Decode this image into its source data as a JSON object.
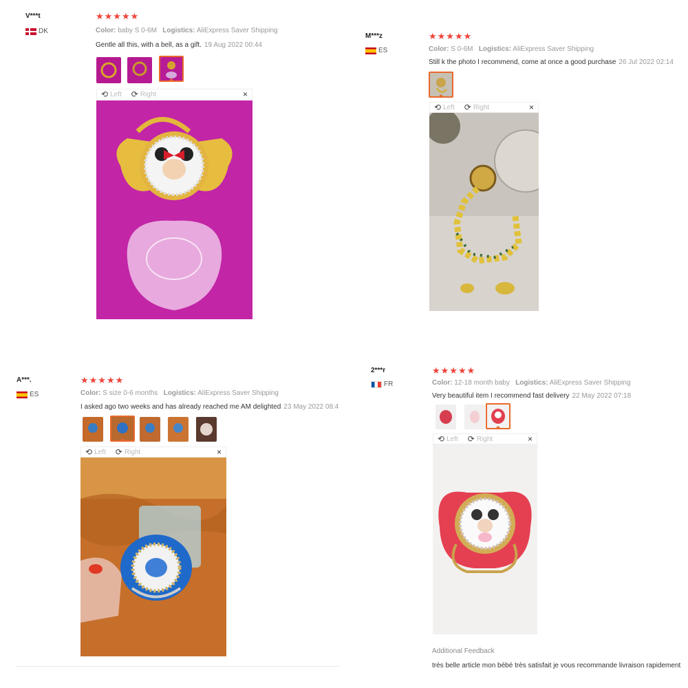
{
  "reviews": [
    {
      "user": "V***t",
      "country": "DK",
      "stars": "★★★★★",
      "color_label": "Color:",
      "color": "baby S 0-6M",
      "logistics_label": "Logistics:",
      "logistics": "AliExpress Saver Shipping",
      "text": "Gentle all this, with a bell, as a gift.",
      "date": "19 Aug 2022 00:44",
      "toolbar": {
        "left": "Left",
        "right": "Right",
        "close": "×"
      }
    },
    {
      "user": "M***z",
      "country": "ES",
      "stars": "★★★★★",
      "color_label": "Color:",
      "color": "S 0-6M",
      "logistics_label": "Logistics:",
      "logistics": "AliExpress Saver Shipping",
      "text": "Still k the photo I recommend, come at once a good purchase",
      "date": "26 Jul 2022 02:14",
      "toolbar": {
        "left": "Left",
        "right": "Right",
        "close": "×"
      }
    },
    {
      "user": "A***.",
      "country": "ES",
      "stars": "★★★★★",
      "color_label": "Color:",
      "color": "S size 0-6 months",
      "logistics_label": "Logistics:",
      "logistics": "AliExpress Saver Shipping",
      "text": "I asked ago two weeks and has already reached me AM delighted",
      "date": "23 May 2022 08:4",
      "toolbar": {
        "left": "Left",
        "right": "Right",
        "close": "×"
      }
    },
    {
      "user": "2***r",
      "country": "FR",
      "stars": "★★★★★",
      "color_label": "Color:",
      "color": "12-18 month baby",
      "logistics_label": "Logistics:",
      "logistics": "AliExpress Saver Shipping",
      "text": "Very beautiful item I recommend fast delivery",
      "date": "22 May 2022 07:18",
      "toolbar": {
        "left": "Left",
        "right": "Right",
        "close": "×"
      },
      "additional_feedback_label": "Additional Feedback",
      "additional_feedback": "très belle article mon bébé très satisfait je vous recommande livraison rapidement"
    }
  ],
  "colors": {
    "star": "#f0433a",
    "accent": "#e9692c",
    "muted": "#999999"
  }
}
